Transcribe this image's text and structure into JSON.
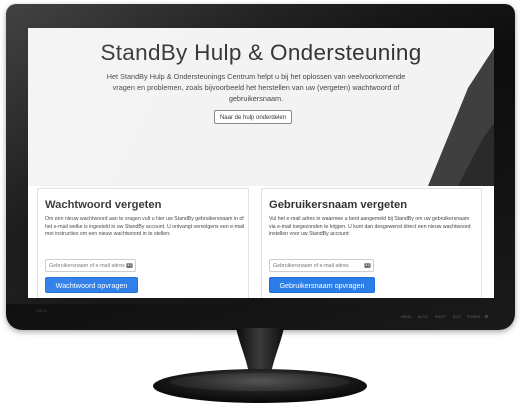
{
  "hero": {
    "title": "StandBy Hulp & Ondersteuning",
    "description": "Het StandBy Hulp & Ondersteunings Centrum helpt u bij het oplossen van veelvoorkomende vragen en problemen, zoals bijvoorbeeld het herstellen van uw (vergeten) wachtwoord of gebruikersnaam.",
    "button_label": "Naar de hulp onderdelen"
  },
  "password_card": {
    "title": "Wachtwoord vergeten",
    "description": "Om een nieuw wachtwoord aan te vragen vult u hier uw StandBy gebruikersnaam in of het e-mail welke is ingesteld in uw StandBy account. U ontvangt vervolgens een e-mail met instructies om een nieuw wachtwoord in te stellen:",
    "input_placeholder": "Gebruikersnaam of e-mail adres",
    "button_label": "Wachtwoord opvragen"
  },
  "username_card": {
    "title": "Gebruikersnaam vergeten",
    "description": "Vul het e-mail adres in waarmee u bent aangemeld bij StandBy om uw gebruikersnaam via e-mail toegezonden te krijgen. U kunt dan desgewenst direct een nieuw wachtwoord instellen voor uw StandBy account:",
    "input_placeholder": "Gebruikersnaam of e-mail adres",
    "button_label": "Gebruikersnaam opvragen"
  },
  "monitor": {
    "logo_text": "DELL",
    "controls": [
      "MENU",
      "AUTO",
      "INPUT",
      "ECO",
      "POWER"
    ]
  },
  "colors": {
    "accent": "#2b7de9",
    "hero_background": "#f3f3f3",
    "dark_shape": "#3a3a3a",
    "bezel": "#151515"
  },
  "icons": {
    "field_icon": "contact-card-icon"
  }
}
